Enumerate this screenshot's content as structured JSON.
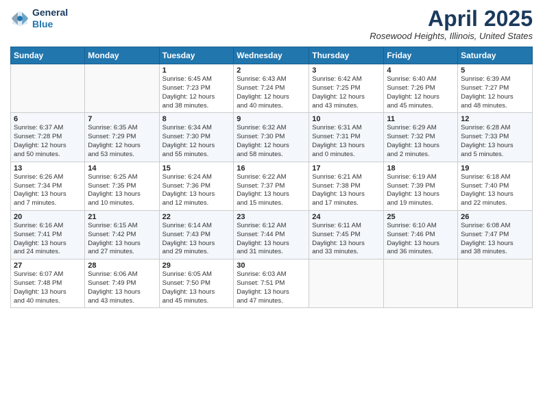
{
  "header": {
    "logo_line1": "General",
    "logo_line2": "Blue",
    "month": "April 2025",
    "location": "Rosewood Heights, Illinois, United States"
  },
  "days_of_week": [
    "Sunday",
    "Monday",
    "Tuesday",
    "Wednesday",
    "Thursday",
    "Friday",
    "Saturday"
  ],
  "weeks": [
    [
      {
        "day": "",
        "info": ""
      },
      {
        "day": "",
        "info": ""
      },
      {
        "day": "1",
        "info": "Sunrise: 6:45 AM\nSunset: 7:23 PM\nDaylight: 12 hours\nand 38 minutes."
      },
      {
        "day": "2",
        "info": "Sunrise: 6:43 AM\nSunset: 7:24 PM\nDaylight: 12 hours\nand 40 minutes."
      },
      {
        "day": "3",
        "info": "Sunrise: 6:42 AM\nSunset: 7:25 PM\nDaylight: 12 hours\nand 43 minutes."
      },
      {
        "day": "4",
        "info": "Sunrise: 6:40 AM\nSunset: 7:26 PM\nDaylight: 12 hours\nand 45 minutes."
      },
      {
        "day": "5",
        "info": "Sunrise: 6:39 AM\nSunset: 7:27 PM\nDaylight: 12 hours\nand 48 minutes."
      }
    ],
    [
      {
        "day": "6",
        "info": "Sunrise: 6:37 AM\nSunset: 7:28 PM\nDaylight: 12 hours\nand 50 minutes."
      },
      {
        "day": "7",
        "info": "Sunrise: 6:35 AM\nSunset: 7:29 PM\nDaylight: 12 hours\nand 53 minutes."
      },
      {
        "day": "8",
        "info": "Sunrise: 6:34 AM\nSunset: 7:30 PM\nDaylight: 12 hours\nand 55 minutes."
      },
      {
        "day": "9",
        "info": "Sunrise: 6:32 AM\nSunset: 7:30 PM\nDaylight: 12 hours\nand 58 minutes."
      },
      {
        "day": "10",
        "info": "Sunrise: 6:31 AM\nSunset: 7:31 PM\nDaylight: 13 hours\nand 0 minutes."
      },
      {
        "day": "11",
        "info": "Sunrise: 6:29 AM\nSunset: 7:32 PM\nDaylight: 13 hours\nand 2 minutes."
      },
      {
        "day": "12",
        "info": "Sunrise: 6:28 AM\nSunset: 7:33 PM\nDaylight: 13 hours\nand 5 minutes."
      }
    ],
    [
      {
        "day": "13",
        "info": "Sunrise: 6:26 AM\nSunset: 7:34 PM\nDaylight: 13 hours\nand 7 minutes."
      },
      {
        "day": "14",
        "info": "Sunrise: 6:25 AM\nSunset: 7:35 PM\nDaylight: 13 hours\nand 10 minutes."
      },
      {
        "day": "15",
        "info": "Sunrise: 6:24 AM\nSunset: 7:36 PM\nDaylight: 13 hours\nand 12 minutes."
      },
      {
        "day": "16",
        "info": "Sunrise: 6:22 AM\nSunset: 7:37 PM\nDaylight: 13 hours\nand 15 minutes."
      },
      {
        "day": "17",
        "info": "Sunrise: 6:21 AM\nSunset: 7:38 PM\nDaylight: 13 hours\nand 17 minutes."
      },
      {
        "day": "18",
        "info": "Sunrise: 6:19 AM\nSunset: 7:39 PM\nDaylight: 13 hours\nand 19 minutes."
      },
      {
        "day": "19",
        "info": "Sunrise: 6:18 AM\nSunset: 7:40 PM\nDaylight: 13 hours\nand 22 minutes."
      }
    ],
    [
      {
        "day": "20",
        "info": "Sunrise: 6:16 AM\nSunset: 7:41 PM\nDaylight: 13 hours\nand 24 minutes."
      },
      {
        "day": "21",
        "info": "Sunrise: 6:15 AM\nSunset: 7:42 PM\nDaylight: 13 hours\nand 27 minutes."
      },
      {
        "day": "22",
        "info": "Sunrise: 6:14 AM\nSunset: 7:43 PM\nDaylight: 13 hours\nand 29 minutes."
      },
      {
        "day": "23",
        "info": "Sunrise: 6:12 AM\nSunset: 7:44 PM\nDaylight: 13 hours\nand 31 minutes."
      },
      {
        "day": "24",
        "info": "Sunrise: 6:11 AM\nSunset: 7:45 PM\nDaylight: 13 hours\nand 33 minutes."
      },
      {
        "day": "25",
        "info": "Sunrise: 6:10 AM\nSunset: 7:46 PM\nDaylight: 13 hours\nand 36 minutes."
      },
      {
        "day": "26",
        "info": "Sunrise: 6:08 AM\nSunset: 7:47 PM\nDaylight: 13 hours\nand 38 minutes."
      }
    ],
    [
      {
        "day": "27",
        "info": "Sunrise: 6:07 AM\nSunset: 7:48 PM\nDaylight: 13 hours\nand 40 minutes."
      },
      {
        "day": "28",
        "info": "Sunrise: 6:06 AM\nSunset: 7:49 PM\nDaylight: 13 hours\nand 43 minutes."
      },
      {
        "day": "29",
        "info": "Sunrise: 6:05 AM\nSunset: 7:50 PM\nDaylight: 13 hours\nand 45 minutes."
      },
      {
        "day": "30",
        "info": "Sunrise: 6:03 AM\nSunset: 7:51 PM\nDaylight: 13 hours\nand 47 minutes."
      },
      {
        "day": "",
        "info": ""
      },
      {
        "day": "",
        "info": ""
      },
      {
        "day": "",
        "info": ""
      }
    ]
  ]
}
